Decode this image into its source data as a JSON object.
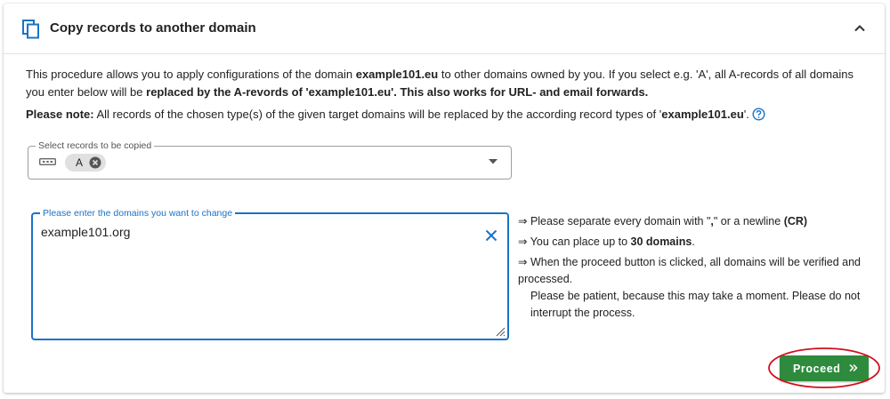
{
  "header": {
    "title": "Copy records to another domain",
    "icons": {
      "leading": "copy-icon",
      "trailing": "chevron-up-icon"
    }
  },
  "intro": {
    "p1_a": "This procedure allows you to apply configurations of the domain ",
    "p1_domain": "example101.eu",
    "p1_b": " to other domains owned by you. If you select e.g. 'A', all A-records of all domains you enter below will be ",
    "p1_bold": "replaced by the A-revords of 'example101.eu'. This also works for URL- and email forwards.",
    "note_label": "Please note:",
    "note_text": " All records of the chosen type(s) of the given target domains will be replaced by the according record types of '",
    "note_domain": "example101.eu",
    "note_end": "'."
  },
  "record_select": {
    "label": "Select records to be copied",
    "chips": [
      "A"
    ]
  },
  "domains_input": {
    "label": "Please enter the domains you want to change",
    "value": "example101.org"
  },
  "hints": {
    "h1_text": "⇒ Please separate every domain with \"",
    "h1_comma": ",",
    "h1_mid": "\" or a newline ",
    "h1_cr": "(CR)",
    "h2_text": "⇒ You can place up to ",
    "h2_bold": "30 domains",
    "h2_end": ".",
    "h3": "⇒ When the proceed button is clicked, all domains will be verified and processed.",
    "h4": "Please be patient, because this may take a moment. Please do not interrupt the process."
  },
  "actions": {
    "proceed_label": "Proceed"
  },
  "colors": {
    "accent": "#1a73c8",
    "proceed_bg": "#2e8b3e",
    "highlight_ring": "#d0101c"
  }
}
